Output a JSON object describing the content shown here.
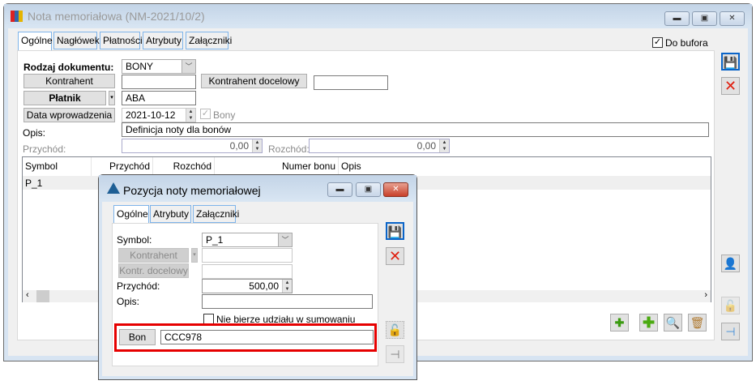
{
  "main": {
    "title": "Nota memoriałowa (NM-2021/10/2)",
    "tabs": [
      "Ogólne",
      "Nagłówek",
      "Płatności",
      "Atrybuty",
      "Załączniki"
    ],
    "do_bufora": "Do bufora",
    "rodzaj_label": "Rodzaj dokumentu:",
    "rodzaj_value": "BONY",
    "kontrahent_btn": "Kontrahent",
    "kontrahent_value": "",
    "kontrahent_docelowy_btn": "Kontrahent docelowy",
    "kontrahent_docelowy_value": "",
    "platnik_btn": "Płatnik",
    "platnik_value": "ABA",
    "data_btn": "Data wprowadzenia",
    "data_value": "2021-10-12",
    "bony_label": "Bony",
    "opis_label": "Opis:",
    "opis_value": "Definicja noty dla bonów",
    "przychod_label": "Przychód:",
    "przychod_value": "0,00",
    "rozchod_label": "Rozchód:",
    "rozchod_value": "0,00",
    "table": {
      "columns": [
        "Symbol",
        "Przychód",
        "Rozchód",
        "Numer bonu",
        "Opis"
      ],
      "rows": [
        [
          "P_1",
          "",
          "",
          "",
          ""
        ]
      ]
    }
  },
  "dialog": {
    "title": "Pozycja noty memoriałowej",
    "tabs": [
      "Ogólne",
      "Atrybuty",
      "Załączniki"
    ],
    "symbol_label": "Symbol:",
    "symbol_value": "P_1",
    "kontrahent_btn": "Kontrahent",
    "kontr_docelowy_btn": "Kontr. docelowy",
    "przychod_label": "Przychód:",
    "przychod_value": "500,00",
    "opis_label": "Opis:",
    "opis_value": "",
    "nie_bierze_label": "Nie bierze udziału w sumowaniu",
    "bon_btn": "Bon",
    "bon_value": "CCC978"
  },
  "colors": {
    "highlight": "#e60000",
    "accent": "#0a64c8"
  }
}
